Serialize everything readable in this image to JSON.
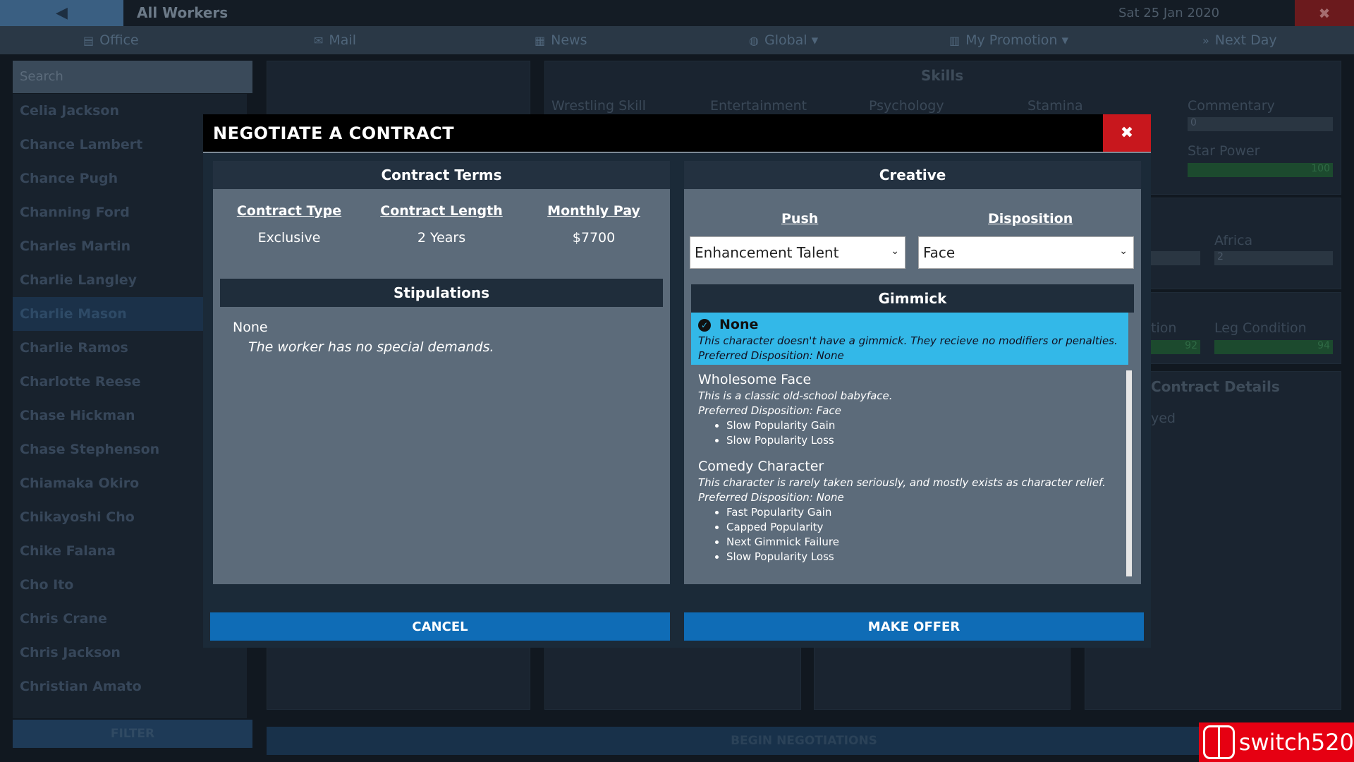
{
  "topbar": {
    "title": "All Workers",
    "date": "Sat 25 Jan 2020",
    "back_icon": "◀",
    "close_icon": "✖"
  },
  "nav": [
    {
      "label": "Office",
      "icon": "calendar-icon",
      "glyph": "▤"
    },
    {
      "label": "Mail",
      "icon": "mail-icon",
      "glyph": "✉"
    },
    {
      "label": "News",
      "icon": "newspaper-icon",
      "glyph": "▦"
    },
    {
      "label": "Global ▾",
      "icon": "globe-icon",
      "glyph": "◍"
    },
    {
      "label": "My Promotion ▾",
      "icon": "building-icon",
      "glyph": "▥"
    },
    {
      "label": "Next Day",
      "icon": "double-chevron-icon",
      "glyph": "»"
    }
  ],
  "sidebar": {
    "search_placeholder": "Search",
    "workers": [
      "Celia Jackson",
      "Chance Lambert",
      "Chance Pugh",
      "Channing Ford",
      "Charles Martin",
      "Charlie Langley",
      "Charlie Mason",
      "Charlie Ramos",
      "Charlotte Reese",
      "Chase Hickman",
      "Chase Stephenson",
      "Chiamaka Okiro",
      "Chikayoshi Cho",
      "Chike Falana",
      "Cho Ito",
      "Chris Crane",
      "Chris Jackson",
      "Christian Amato"
    ],
    "selected_worker": "Charlie Mason",
    "filter_label": "FILTER"
  },
  "background": {
    "skills_title": "Skills",
    "skill_labels": [
      "Wrestling Skill",
      "Entertainment",
      "Psychology",
      "Stamina",
      "Commentary",
      "Star Power"
    ],
    "commentary_value": "0",
    "star_power_value": "100",
    "region_label": "Africa",
    "region_value": "2",
    "partial_label": "tion",
    "partial_value": "92",
    "leg_label": "Leg Condition",
    "leg_value": "94",
    "contract_details": "Contract Details",
    "contract_partial": "yed",
    "begin_label": "BEGIN NEGOTIATIONS"
  },
  "modal": {
    "title": "NEGOTIATE A CONTRACT",
    "close_icon": "✖",
    "terms": {
      "header": "Contract Terms",
      "items": [
        {
          "label": "Contract Type",
          "value": "Exclusive"
        },
        {
          "label": "Contract Length",
          "value": "2 Years"
        },
        {
          "label": "Monthly Pay",
          "value": "$7700"
        }
      ],
      "stipulations_header": "Stipulations",
      "stipulation_title": "None",
      "stipulation_desc": "The worker has no special demands."
    },
    "creative": {
      "header": "Creative",
      "push_label": "Push",
      "push_value": "Enhancement Talent",
      "disposition_label": "Disposition",
      "disposition_value": "Face",
      "gimmick_header": "Gimmick",
      "gimmicks": [
        {
          "name": "None",
          "desc": "This character doesn't have a gimmick. They recieve no modifiers or penalties.",
          "pref": "Preferred Disposition: None",
          "mods": [],
          "selected": true
        },
        {
          "name": "Wholesome Face",
          "desc": "This is a classic old-school babyface.",
          "pref": "Preferred Disposition: Face",
          "mods": [
            "Slow Popularity Gain",
            "Slow Popularity Loss"
          ],
          "selected": false
        },
        {
          "name": "Comedy Character",
          "desc": "This character is rarely taken seriously, and mostly exists as character relief.",
          "pref": "Preferred Disposition: None",
          "mods": [
            "Fast Popularity Gain",
            "Capped Popularity",
            "Next Gimmick Failure",
            "Slow Popularity Loss"
          ],
          "selected": false
        }
      ]
    },
    "cancel_label": "CANCEL",
    "offer_label": "MAKE OFFER"
  },
  "watermark": {
    "text": "switch520"
  },
  "colors": {
    "accent": "#0f6cb6",
    "selected": "#33b8e8",
    "close": "#c8171d"
  }
}
